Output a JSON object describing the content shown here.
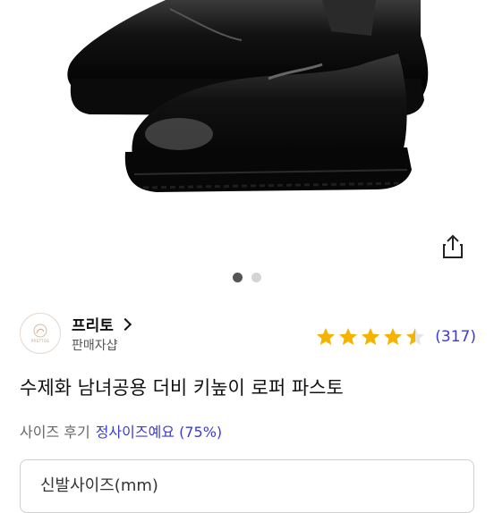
{
  "product": {
    "title": "수제화 남녀공용 더비 키높이 로퍼 파스토",
    "image_alt": "black-derby-shoes-photo",
    "carousel": {
      "count": 2,
      "active_index": 0
    }
  },
  "seller": {
    "name": "프리토",
    "type": "판매자샵",
    "logo_text": "PRETTOE"
  },
  "rating": {
    "stars": 4.5,
    "review_count": "(317)"
  },
  "size_review": {
    "label": "사이즈 후기",
    "value": "정사이즈예요 (75%)"
  },
  "options": {
    "shoe_size_label": "신발사이즈(mm)"
  },
  "colors": {
    "accent": "#3b3bd1",
    "star": "#f5b301"
  }
}
